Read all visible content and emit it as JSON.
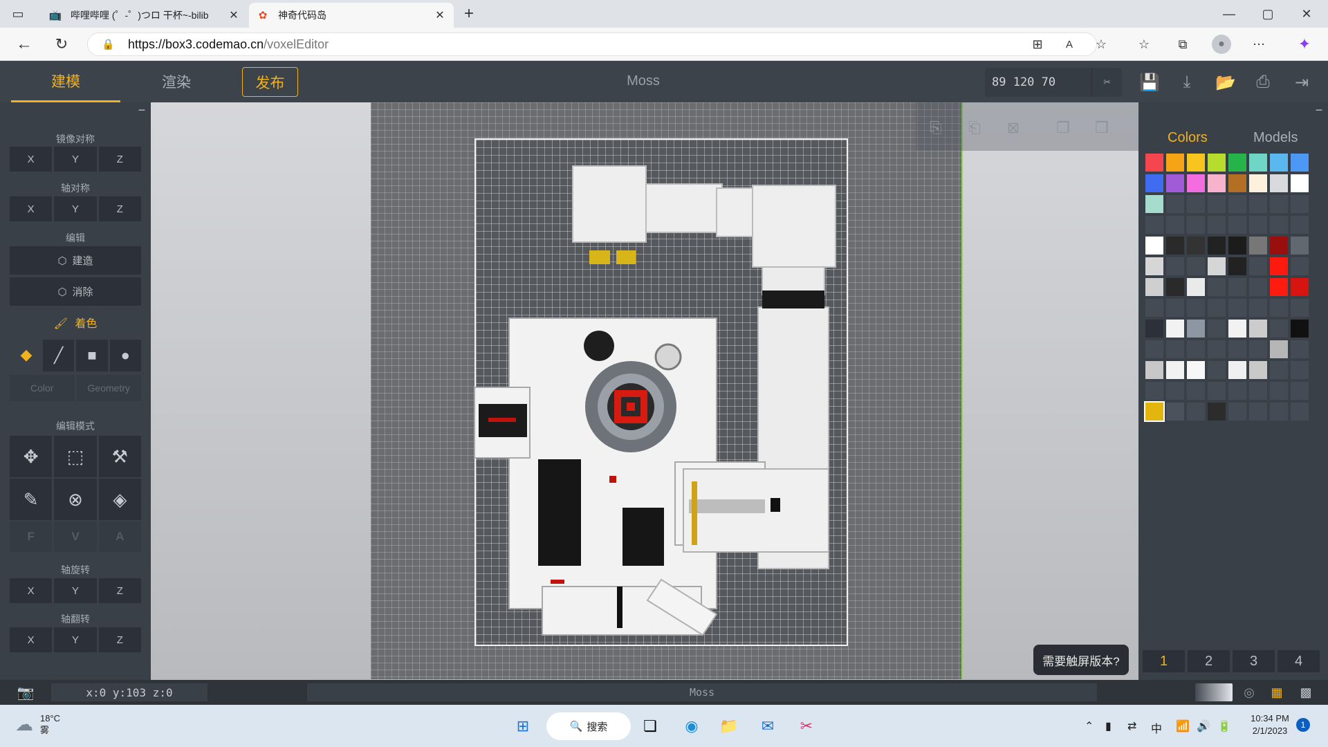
{
  "browser": {
    "tabs": [
      {
        "title": "哔哩哔哩 (゜-゜)つロ 干杯~-bilib",
        "active": false
      },
      {
        "title": "神奇代码岛",
        "active": true
      }
    ],
    "new_tab": "+",
    "url_host": "https://box3.codemao.cn",
    "url_path": "/voxelEditor",
    "window_controls": [
      "—",
      "▢",
      "✕"
    ]
  },
  "editor": {
    "tabs": [
      {
        "label": "建模",
        "selected": true
      },
      {
        "label": "渲染",
        "selected": false
      }
    ],
    "publish_label": "发布",
    "title": "Moss",
    "coords_value": "89 120 70"
  },
  "left_panel": {
    "collapse": "−",
    "mirror_label": "镜像对称",
    "axis_sym_label": "轴对称",
    "edit_label": "编辑",
    "build_label": "建造",
    "erase_label": "消除",
    "paint_label": "着色",
    "color_label": "Color",
    "geometry_label": "Geometry",
    "edit_mode_label": "编辑模式",
    "fva": [
      "F",
      "V",
      "A"
    ],
    "rotate_label": "轴旋转",
    "flip_label": "轴翻转",
    "axes": [
      "X",
      "Y",
      "Z"
    ]
  },
  "right_panel": {
    "tab_colors": "Colors",
    "tab_models": "Models",
    "collapse": "−",
    "pages": [
      "1",
      "2",
      "3",
      "4"
    ],
    "palette_rows": [
      [
        "#f5464f",
        "#f7a316",
        "#f7c51d",
        "#b6dd2e",
        "#26b44a",
        "#6fd6c7",
        "#5ab7f0",
        "#4e98f5"
      ],
      [
        "#3f6cf0",
        "#a25bd8",
        "#f46de0",
        "#f7b3cc",
        "#b36f23",
        "#fdf0dc",
        "#d9dadd",
        "#ffffff"
      ],
      [
        "#a6dcce",
        "#454b54",
        "#454b54",
        "#454b54",
        "#454b54",
        "#454b54",
        "#454b54",
        "#454b54"
      ],
      [
        "#454b54",
        "#454b54",
        "#454b54",
        "#454b54",
        "#454b54",
        "#454b54",
        "#454b54",
        "#454b54"
      ],
      [
        "#ffffff",
        "#2a2a2a",
        "#333333",
        "#222222",
        "#1c1c1c",
        "#777777",
        "#9b0e0e",
        "#626870"
      ],
      [
        "#d6d6d6",
        "#454b54",
        "#454b54",
        "#d6d6d6",
        "#222222",
        "#454b54",
        "#ff1a10",
        "#454b54"
      ],
      [
        "#cfcfcf",
        "#2a2a2a",
        "#eaeaea",
        "#454b54",
        "#454b54",
        "#454b54",
        "#ff1b10",
        "#d81410"
      ],
      [
        "#454b54",
        "#454b54",
        "#454b54",
        "#454b54",
        "#454b54",
        "#454b54",
        "#454b54",
        "#454b54"
      ],
      [
        "#2c3139",
        "#f2f2f2",
        "#8c97a3",
        "#454b54",
        "#f2f2f2",
        "#cccccc",
        "#454b54",
        "#111111"
      ],
      [
        "#454b54",
        "#454b54",
        "#454b54",
        "#454b54",
        "#454b54",
        "#454b54",
        "#b6b6b6",
        "#454b54"
      ],
      [
        "#c8c8c8",
        "#f2f2f2",
        "#f7f7f7",
        "#454b54",
        "#f0f0f0",
        "#c9c9c9",
        "#454b54",
        "#454b54"
      ],
      [
        "#454b54",
        "#454b54",
        "#454b54",
        "#454b54",
        "#454b54",
        "#454b54",
        "#454b54",
        "#454b54"
      ],
      [
        "#e2b60c",
        "#4b525c",
        "#454b54",
        "#2c2c2c",
        "#454b54",
        "#454b54",
        "#454b54",
        "#454b54"
      ]
    ],
    "selected_color": "#e2b60c"
  },
  "viewport": {
    "touch_tip": "需要触屏版本?"
  },
  "status": {
    "coords": "x:0 y:103 z:0",
    "model_name": "Moss"
  },
  "taskbar": {
    "temperature": "18°C",
    "weather": "雾",
    "search": "搜索",
    "ime": "中",
    "time": "10:34 PM",
    "date": "2/1/2023",
    "notifications": "1"
  },
  "colors": {
    "accent": "#f2b21c",
    "panel": "#3a4048",
    "nav": "#3d434b"
  }
}
